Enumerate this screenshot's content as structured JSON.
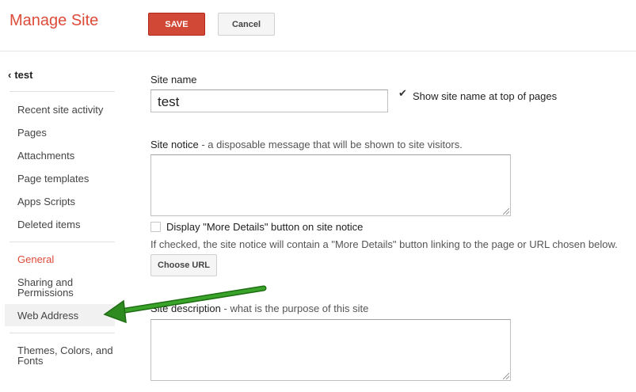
{
  "header": {
    "title": "Manage Site",
    "save_label": "SAVE",
    "cancel_label": "Cancel"
  },
  "sidebar": {
    "back_label": "test",
    "items": [
      {
        "label": "Recent site activity"
      },
      {
        "label": "Pages"
      },
      {
        "label": "Attachments"
      },
      {
        "label": "Page templates"
      },
      {
        "label": "Apps Scripts"
      },
      {
        "label": "Deleted items"
      },
      {
        "label": "General"
      },
      {
        "label": "Sharing and Permissions"
      },
      {
        "label": "Web Address"
      },
      {
        "label": "Themes, Colors, and Fonts"
      }
    ]
  },
  "form": {
    "site_name_label": "Site name",
    "site_name_value": "test",
    "show_site_name_label": "Show site name at top of pages",
    "show_site_name_checked": true,
    "site_notice_label": "Site notice",
    "site_notice_hint": " - a disposable message that will be shown to site visitors.",
    "more_details_label": "Display \"More Details\" button on site notice",
    "more_details_checked": false,
    "more_details_help": "If checked, the site notice will contain a \"More Details\" button linking to the page or URL chosen below.",
    "choose_url_label": "Choose URL",
    "site_description_label": "Site description",
    "site_description_hint": " - what is the purpose of this site"
  },
  "colors": {
    "accent_red": "#dd4b39",
    "save_button": "#d14836",
    "annotation_arrow": "#2e8b1f"
  }
}
